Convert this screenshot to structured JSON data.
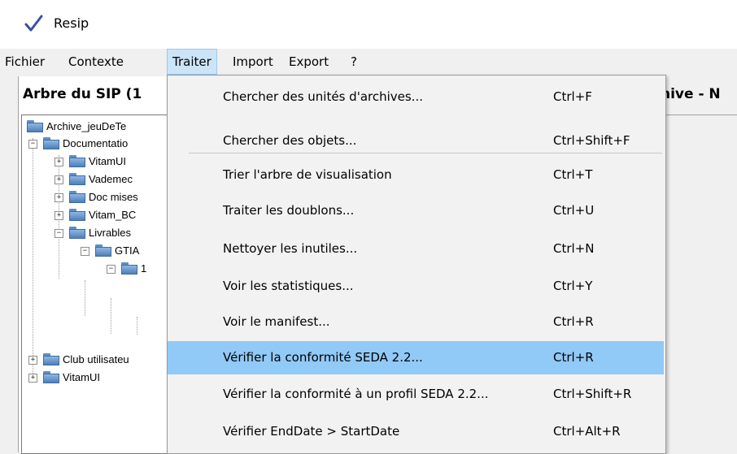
{
  "window": {
    "title": "Resip"
  },
  "menubar": [
    {
      "label": "Fichier"
    },
    {
      "label": "Contexte"
    },
    {
      "label": "Traiter"
    },
    {
      "label": "Import"
    },
    {
      "label": "Export"
    },
    {
      "label": "?"
    }
  ],
  "left_panel": {
    "title": "Arbre du SIP (1"
  },
  "right_panel": {
    "title": "hive - N"
  },
  "tree": [
    {
      "label": "Archive_jeuDeTe"
    },
    {
      "label": "Documentatio"
    },
    {
      "label": "VitamUI"
    },
    {
      "label": "Vademec"
    },
    {
      "label": "Doc mises"
    },
    {
      "label": "Vitam_BC"
    },
    {
      "label": "Livrables"
    },
    {
      "label": "GTIA"
    },
    {
      "label": "1"
    },
    {
      "label": "Club utilisateu"
    },
    {
      "label": "VitamUI"
    }
  ],
  "traiter_menu": [
    {
      "label": "Chercher des unités d'archives...",
      "shortcut": "Ctrl+F"
    },
    {
      "label": "Chercher des objets...",
      "shortcut": "Ctrl+Shift+F"
    },
    {
      "label": "Trier l'arbre de visualisation",
      "shortcut": "Ctrl+T"
    },
    {
      "label": "Traiter les doublons...",
      "shortcut": "Ctrl+U"
    },
    {
      "label": "Nettoyer les inutiles...",
      "shortcut": "Ctrl+N"
    },
    {
      "label": "Voir les statistiques...",
      "shortcut": "Ctrl+Y"
    },
    {
      "label": "Voir le manifest...",
      "shortcut": "Ctrl+R"
    },
    {
      "label": "Vérifier la conformité SEDA 2.2...",
      "shortcut": "Ctrl+R"
    },
    {
      "label": "Vérifier la conformité à un profil SEDA 2.2...",
      "shortcut": "Ctrl+Shift+R"
    },
    {
      "label": "Vérifier EndDate > StartDate",
      "shortcut": "Ctrl+Alt+R"
    }
  ],
  "colors": {
    "highlight": "#91c9f7",
    "menu_active": "#cce4f7",
    "check": "#3b4fa8"
  }
}
